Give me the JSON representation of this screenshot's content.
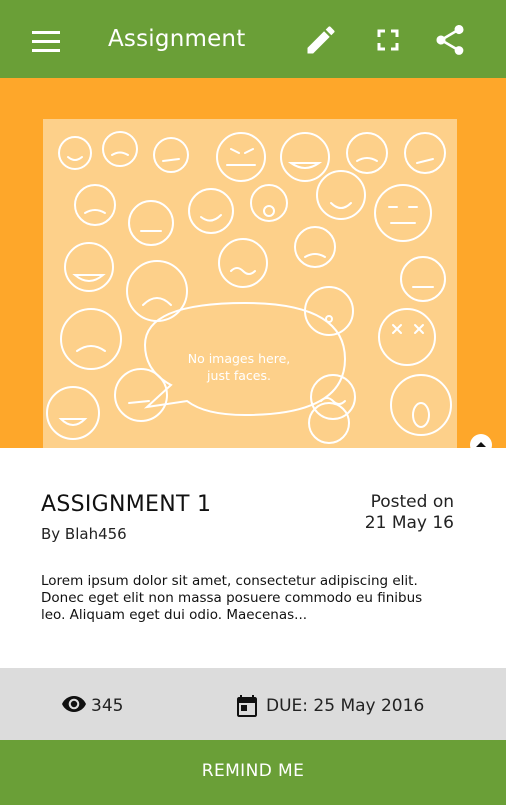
{
  "appbar": {
    "title": "Assignment",
    "menu_icon": "menu-icon",
    "edit_icon": "pencil-icon",
    "fullscreen_icon": "fullscreen-icon",
    "share_icon": "share-icon",
    "color": "#6a9f37"
  },
  "hero": {
    "background": "#fea72a",
    "image_caption_line1": "No images here,",
    "image_caption_line2": "just faces.",
    "collapse_icon": "chevron-up-icon"
  },
  "assignment": {
    "title": "ASSIGNMENT 1",
    "author": "By Blah456",
    "posted_label": "Posted on",
    "posted_date": "21 May 16",
    "description_line1": "Lorem ipsum dolor sit amet, consectetur adipiscing elit.",
    "description_line2": "Donec eget elit non massa posuere commodo eu finibus",
    "description_line3": "leo. Aliquam eget dui odio. Maecenas..."
  },
  "stats": {
    "views": "345",
    "views_icon": "eye-icon",
    "due": "DUE: 25 May 2016",
    "due_icon": "calendar-icon"
  },
  "actions": {
    "remind_label": "REMIND ME"
  }
}
